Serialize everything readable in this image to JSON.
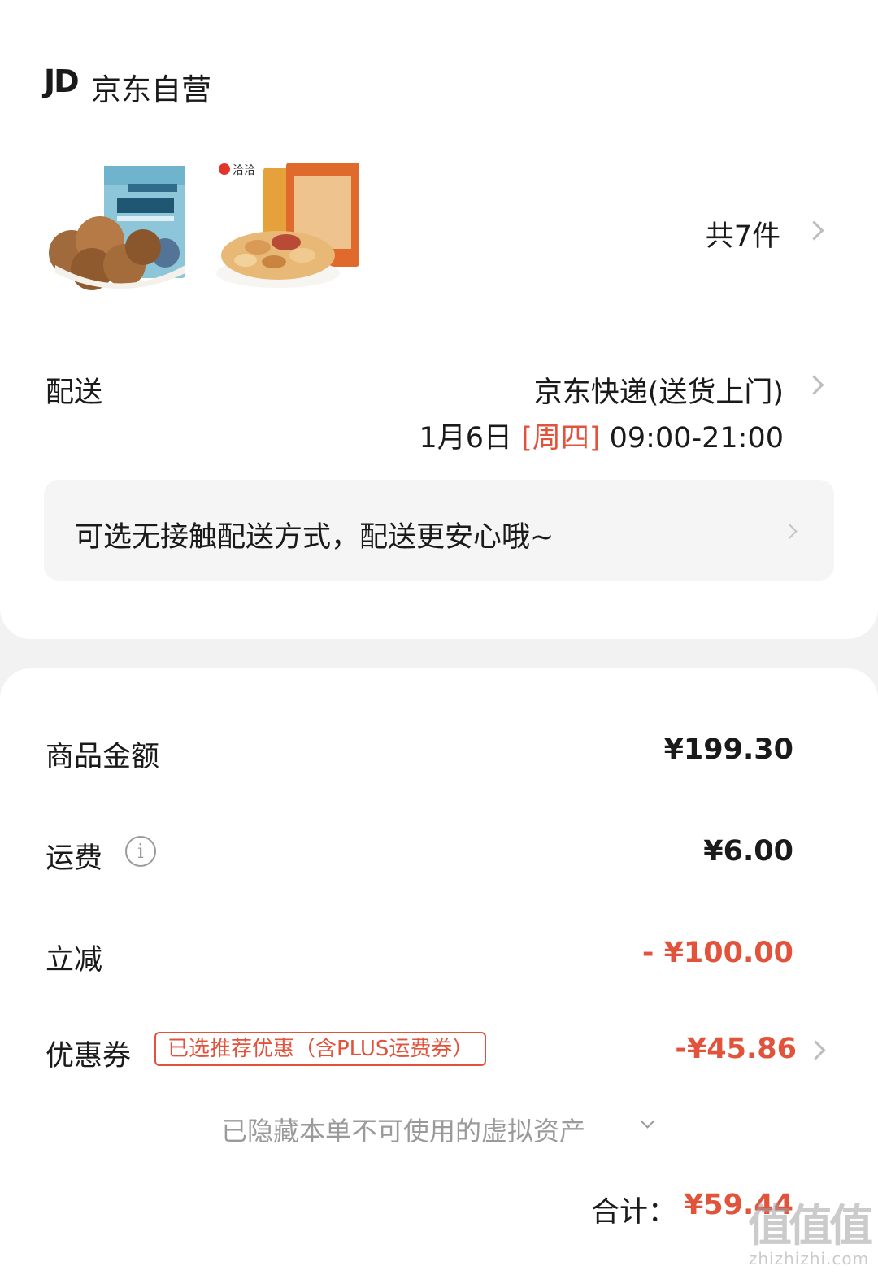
{
  "shop": {
    "logo": "JD",
    "name": "京东自营"
  },
  "items": {
    "count_label": "共7件",
    "thumbnails": [
      {
        "icon": "walnut-package-image"
      },
      {
        "icon": "peanut-package-image",
        "brand": "洽洽"
      }
    ]
  },
  "delivery": {
    "label": "配送",
    "method": "京东快递(送货上门)",
    "date": "1月6日",
    "weekday": "[周四]",
    "time_range": "09:00-21:00",
    "contactless_text": "可选无接触配送方式，配送更安心哦~"
  },
  "summary": {
    "goods_label": "商品金额",
    "goods_value": "¥199.30",
    "shipping_label": "运费",
    "shipping_value": "¥6.00",
    "discount_label": "立减",
    "discount_value": "- ¥100.00",
    "coupon_label": "优惠券",
    "coupon_badge": "已选推荐优惠（含PLUS运费券）",
    "coupon_value": "-¥45.86",
    "hidden_assets": "已隐藏本单不可使用的虚拟资产",
    "total_label": "合计：",
    "total_value": "¥59.44"
  },
  "watermark": {
    "big": "值值值",
    "small": "zhizhizhi.com"
  },
  "colors": {
    "accent": "#e2533c",
    "background": "#f2f2f2",
    "card": "#ffffff"
  }
}
